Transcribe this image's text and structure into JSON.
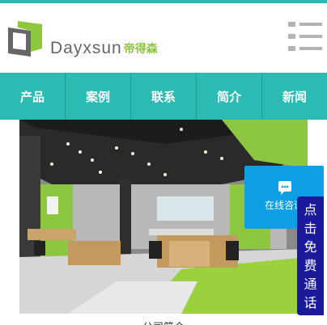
{
  "brand": {
    "name_en": "Dayxsun",
    "name_cn": "帝得森",
    "colors": {
      "teal": "#2bbab4",
      "green": "#8dc63f",
      "gray": "#666666"
    }
  },
  "header": {
    "menu_icon": "hamburger-menu-icon"
  },
  "nav": {
    "items": [
      {
        "label": "产品"
      },
      {
        "label": "案例"
      },
      {
        "label": "联系"
      },
      {
        "label": "简介"
      },
      {
        "label": "新闻"
      }
    ]
  },
  "banner": {
    "alt": "office interior photo"
  },
  "consult": {
    "label": "在线咨询",
    "icon": "chat-bubble-icon",
    "color": "#0e9ee6"
  },
  "free_call": {
    "chars": [
      "点",
      "击",
      "免",
      "费",
      "通",
      "话"
    ],
    "color": "#1a1a9a"
  },
  "bottom": {
    "text": "公司简介"
  }
}
